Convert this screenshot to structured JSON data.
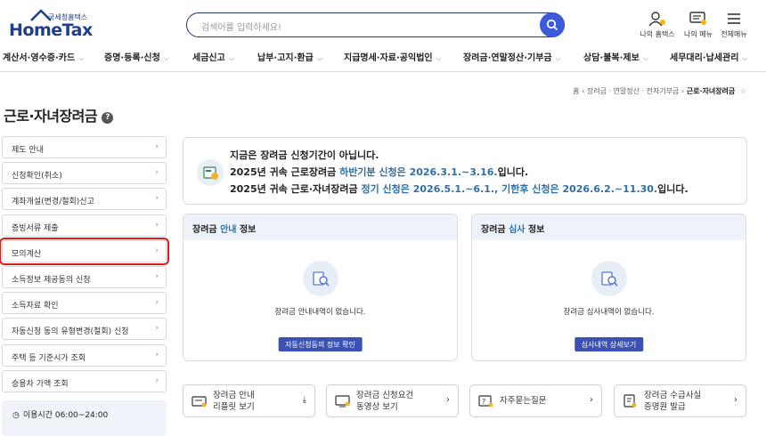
{
  "header": {
    "logo_sub": "국세청홈택스",
    "logo_main": "HomeTax",
    "search_placeholder": "검색어를 입력하세요!",
    "my_hometax": "나의 홈택스",
    "my_menu": "나의 메뉴",
    "all_menu": "전체메뉴"
  },
  "gnb": [
    "계산서·영수증·카드",
    "증명·등록·신청",
    "세금신고",
    "납부·고지·환급",
    "지급명세·자료·공익법인",
    "장려금·연말정산·기부금",
    "상담·불복·제보",
    "세무대리·납세관리"
  ],
  "breadcrumb": {
    "home": "홈",
    "level1": "장려금 · 연말정산 · 전자기부금",
    "current": "근로·자녀장려금"
  },
  "page_title": "근로·자녀장려금",
  "sidebar": {
    "items": [
      "제도 안내",
      "신청확인(취소)",
      "계좌개설(변경/철회)신고",
      "증빙서류 제출",
      "모의계산",
      "소득정보 제공동의 신청",
      "소득자료 확인",
      "자동신청 동의 유형변경(철회) 신청",
      "주택 등 기준시가 조회",
      "승용차 가액 조회"
    ],
    "time_label": "이용시간 06:00~24:00"
  },
  "notice": {
    "line1": "지금은 장려금 신청기간이 아닙니다.",
    "line2_pre": "2025년 귀속 근로장려금 ",
    "line2_blue": "하반기분 신청은 2026.3.1.~3.16.",
    "line2_post": "입니다.",
    "line3_pre": "2025년 귀속 근로·자녀장려금 ",
    "line3_blue": "정기 신청은 2026.5.1.~6.1., 기한후 신청은 2026.6.2.~11.30.",
    "line3_post": "입니다."
  },
  "panel_guide": {
    "title_pre": "장려금 ",
    "title_blue": "안내",
    "title_post": " 정보",
    "empty": "장려금 안내내역이 없습니다.",
    "button": "자동신청동의 정보 확인"
  },
  "panel_review": {
    "title_pre": "장려금 ",
    "title_blue": "심사",
    "title_post": " 정보",
    "empty": "장려금 심사내역이 없습니다.",
    "button": "심사내역 상세보기"
  },
  "quick": [
    {
      "line1": "장려금 안내",
      "line2": "리플릿 보기",
      "arrow": "⤓"
    },
    {
      "line1": "장려금 신청요건",
      "line2": "동영상 보기",
      "arrow": "›"
    },
    {
      "line1": "자주묻는질문",
      "line2": "",
      "arrow": "›"
    },
    {
      "line1": "장려금 수급사실",
      "line2": "증명원 발급",
      "arrow": "›"
    }
  ],
  "colors": {
    "brand": "#1e3f8a",
    "accent": "#3b5bdb",
    "highlight": "#e0191b",
    "link": "#2f6fa8"
  }
}
